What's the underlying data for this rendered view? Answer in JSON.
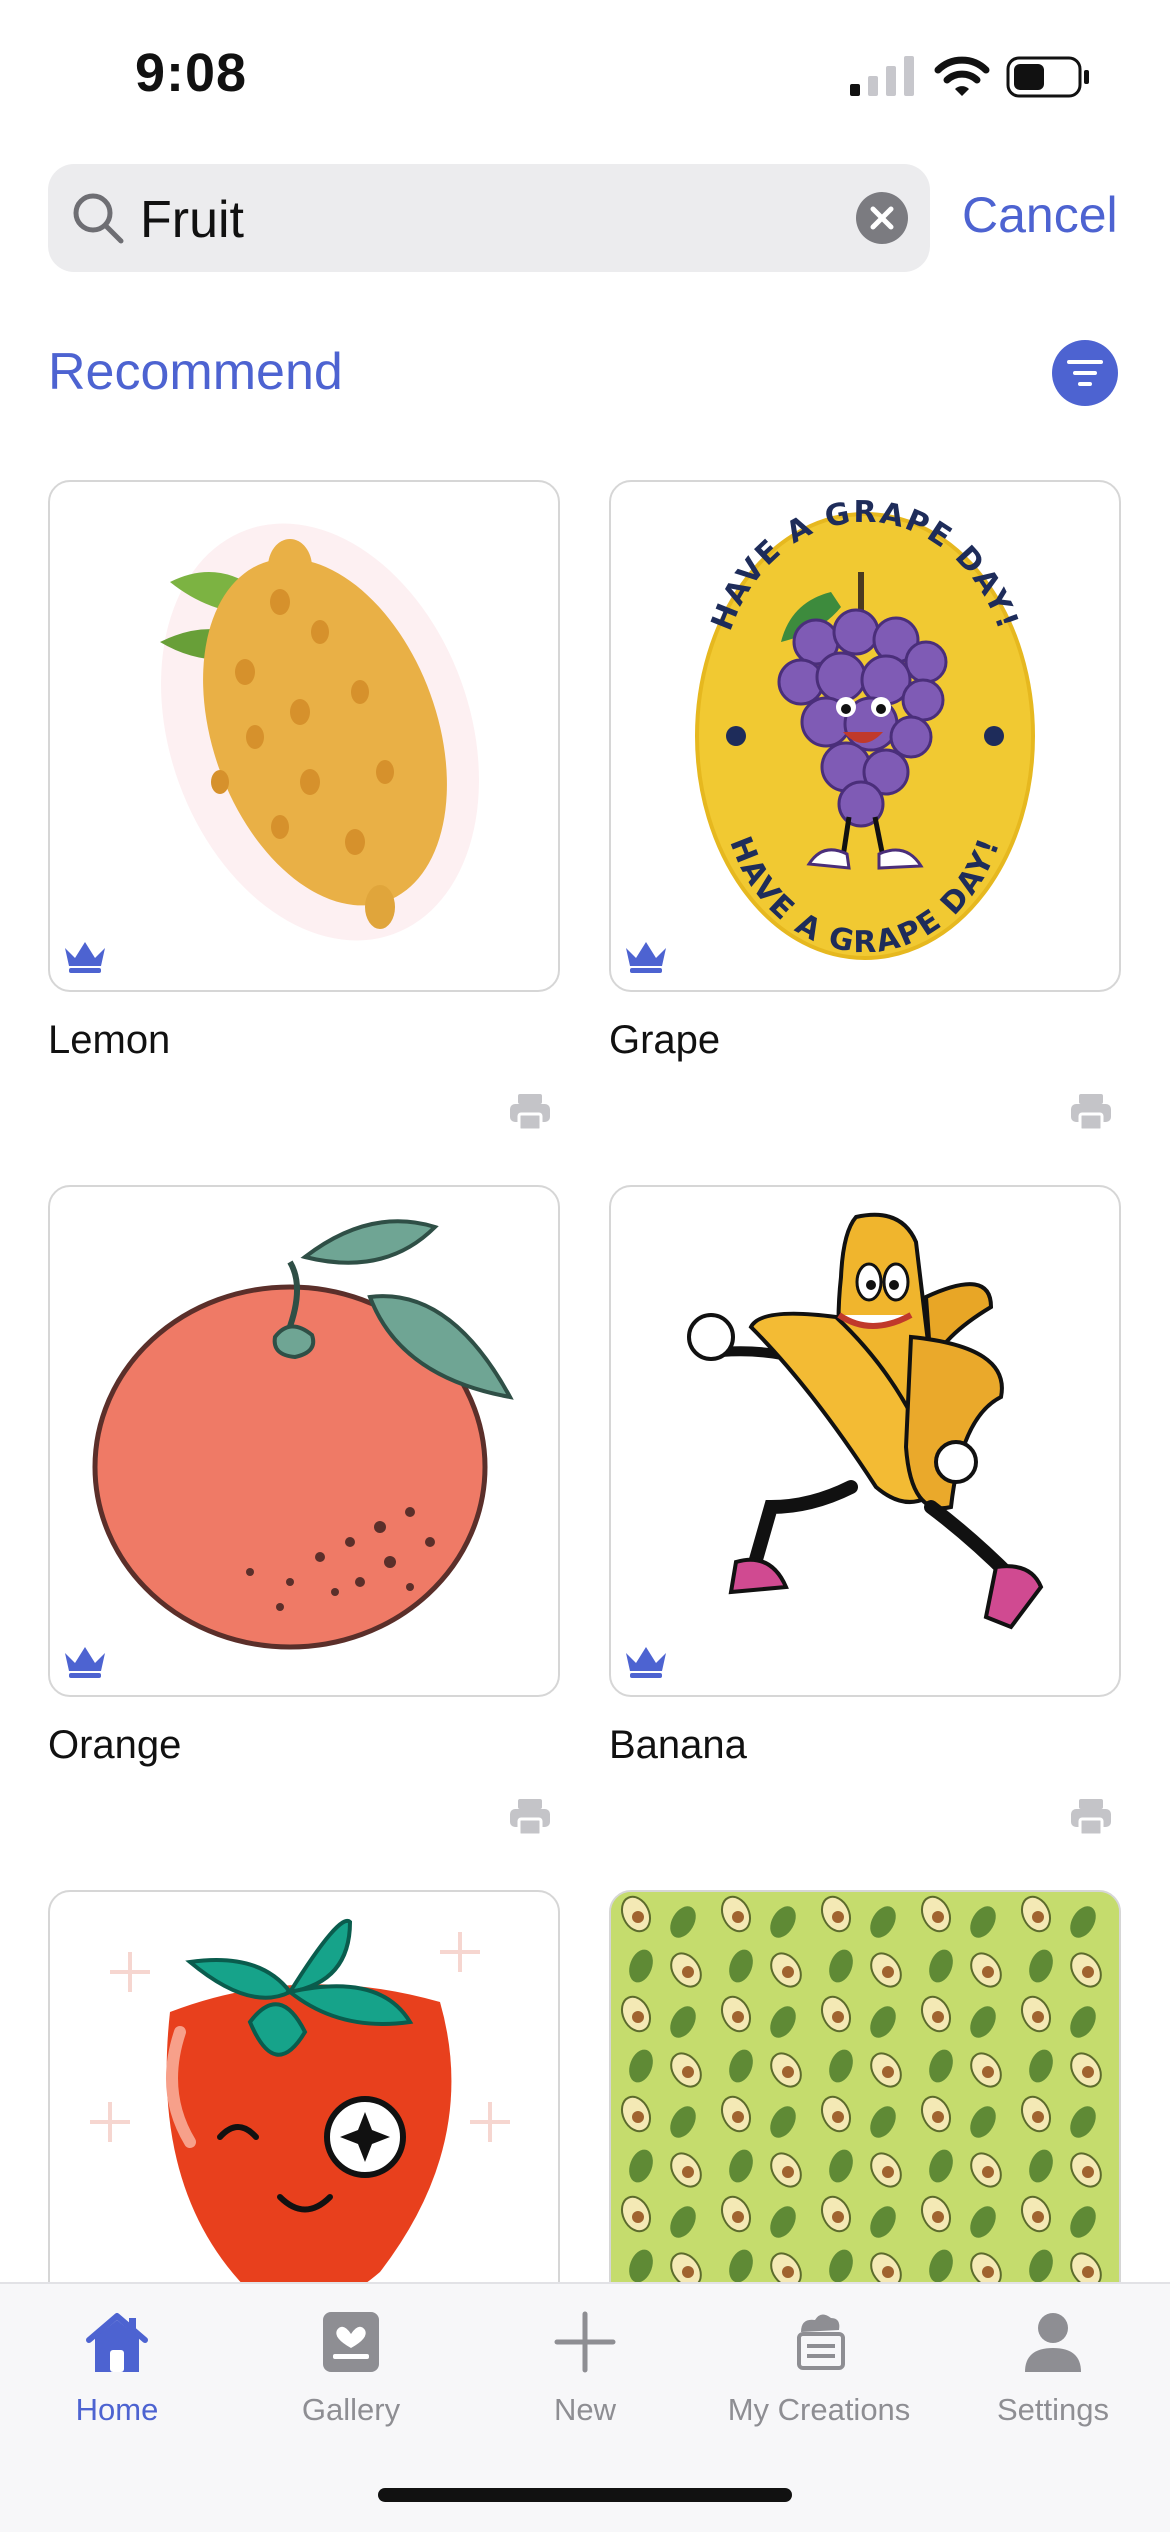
{
  "status_bar": {
    "time": "9:08"
  },
  "search": {
    "value": "Fruit",
    "cancel_label": "Cancel"
  },
  "section": {
    "title": "Recommend"
  },
  "items": [
    {
      "title": "Lemon",
      "premium": true
    },
    {
      "title": "Grape",
      "premium": true,
      "art_text_top": "HAVE A GRAPE DAY!",
      "art_text_bottom": "HAVE A GRAPE DAY!"
    },
    {
      "title": "Orange",
      "premium": true
    },
    {
      "title": "Banana",
      "premium": true
    },
    {
      "title": "",
      "premium": false
    },
    {
      "title": "",
      "premium": false
    }
  ],
  "tabs": [
    {
      "label": "Home",
      "icon": "home-icon",
      "active": true
    },
    {
      "label": "Gallery",
      "icon": "gallery-icon",
      "active": false
    },
    {
      "label": "New",
      "icon": "plus-icon",
      "active": false
    },
    {
      "label": "My Creations",
      "icon": "creations-icon",
      "active": false
    },
    {
      "label": "Settings",
      "icon": "person-icon",
      "active": false
    }
  ],
  "colors": {
    "accent": "#4d63d1",
    "tab_inactive": "#8e8e93",
    "search_bg": "#ececee"
  }
}
